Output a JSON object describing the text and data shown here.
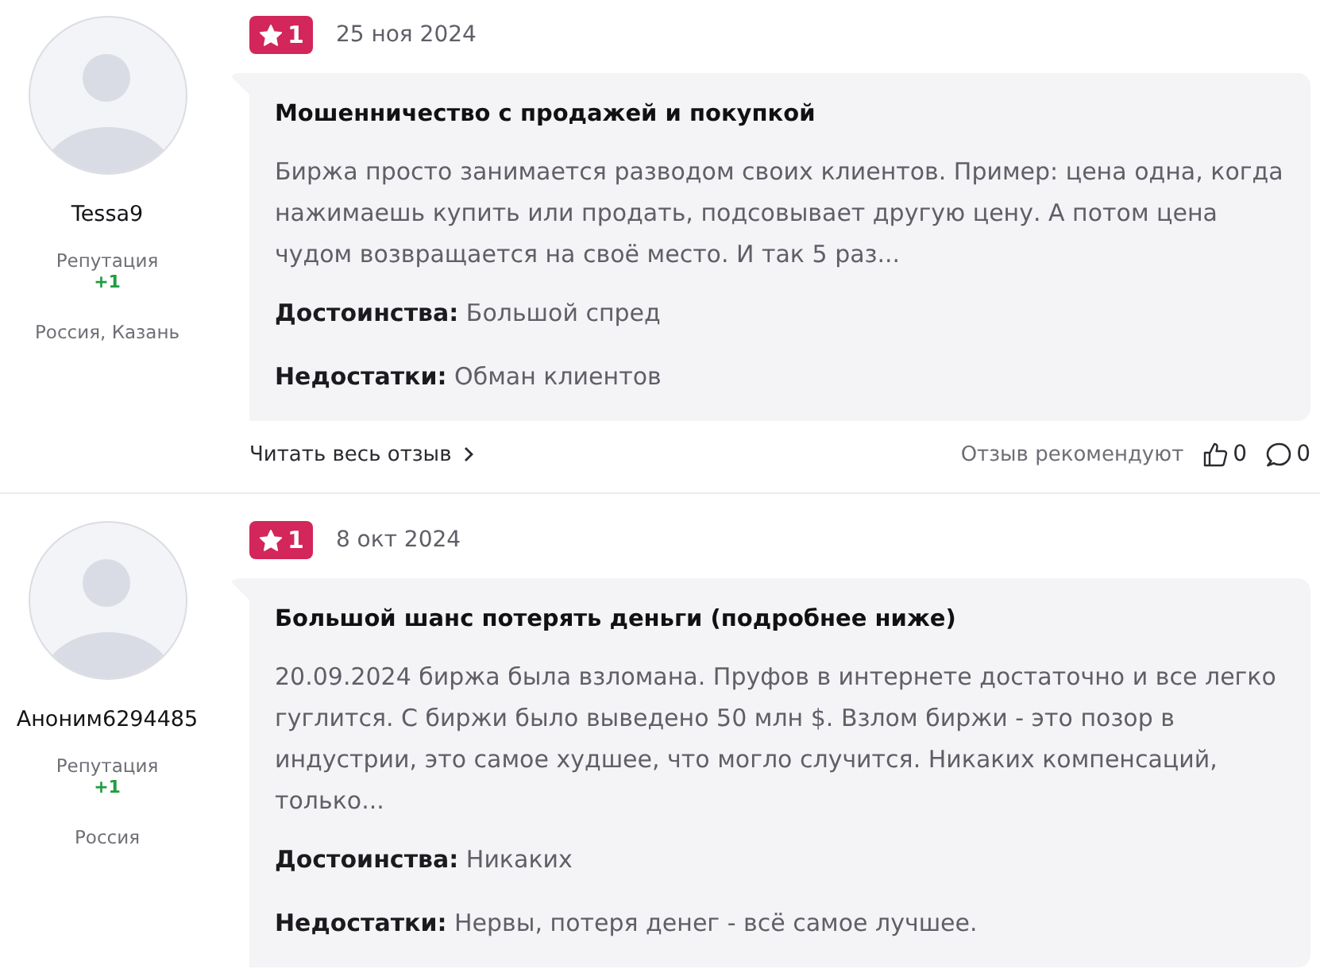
{
  "reviews": [
    {
      "author": {
        "name": "Tessa9",
        "reputation_label": "Репутация",
        "reputation": "+1",
        "location": "Россия, Казань"
      },
      "rating": "1",
      "date": "25 ноя 2024",
      "title": "Мошенничество с продажей и покупкой",
      "text": "Биржа просто занимается разводом своих клиентов. Пример: цена одна, когда нажимаешь купить или продать, подсовывает другую цену. А потом цена чудом возвращается на своё место. И так 5 раз...",
      "pros": "**Достоинства:** Большой спред",
      "cons": "**Недостатки:** Обман клиентов",
      "footer": {
        "read_more": "Читать весь отзыв",
        "recommend_label": "Отзыв рекомендуют",
        "likes": "0",
        "comments": "0"
      }
    },
    {
      "author": {
        "name": "Аноним6294485",
        "reputation_label": "Репутация",
        "reputation": "+1",
        "location": "Россия"
      },
      "rating": "1",
      "date": "8 окт 2024",
      "title": "Большой шанс потерять деньги (подробнее ниже)",
      "text": "20.09.2024 биржа была взломана. Пруфов в интернете достаточно и все легко гуглится. С биржи было выведено 50 млн $. Взлом биржи - это позор в индустрии, это самое худшее, что могло случится. Никаких компенсаций, только...",
      "pros": "**Достоинства:** Никаких",
      "cons": "**Недостатки:** Нервы, потеря денег - всё самое лучшее."
    }
  ]
}
